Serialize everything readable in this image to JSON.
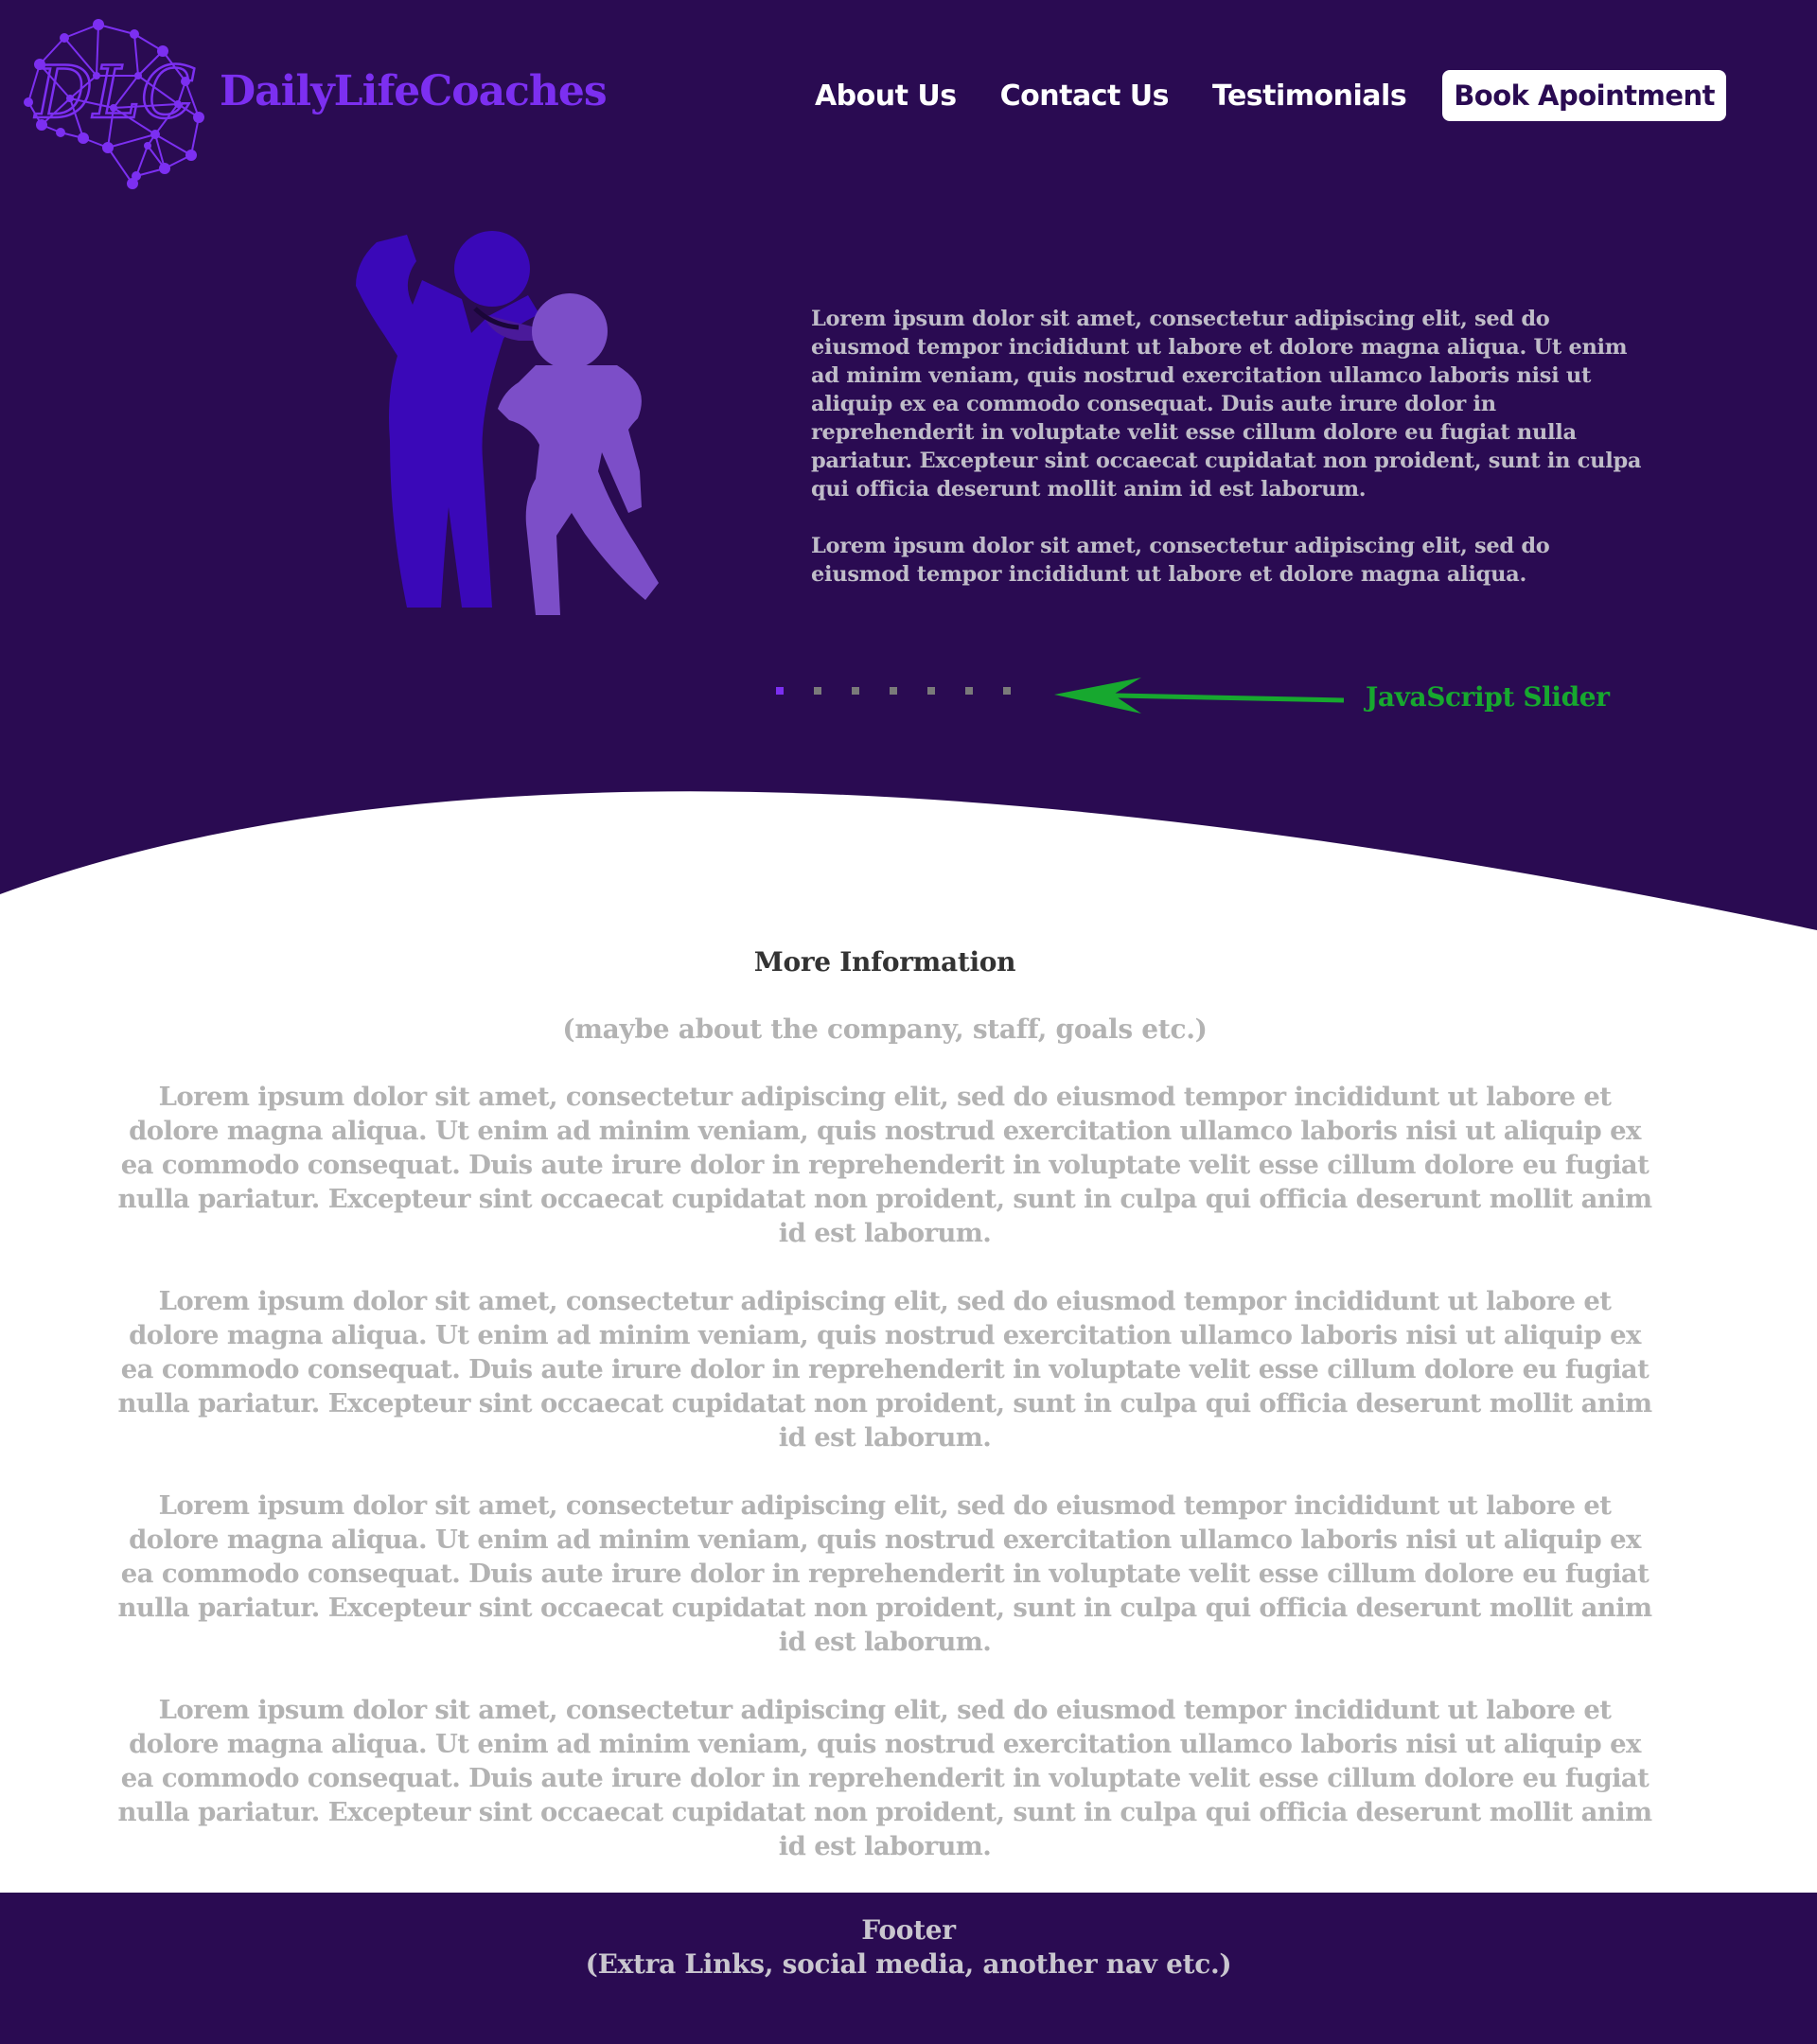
{
  "brand": {
    "name": "DailyLifeCoaches",
    "logo_letters": "DLC",
    "color": "#7c2ff1"
  },
  "nav": {
    "links": [
      "About Us",
      "Contact Us",
      "Testimonials"
    ],
    "cta": "Book Apointment"
  },
  "hero": {
    "paragraphs": [
      "Lorem ipsum dolor sit amet, consectetur adipiscing elit, sed do eiusmod tempor incididunt ut labore et dolore magna aliqua. Ut enim ad minim veniam, quis nostrud exercitation ullamco laboris nisi ut aliquip ex ea commodo consequat. Duis aute irure dolor in reprehenderit in voluptate velit esse cillum dolore eu fugiat nulla pariatur. Excepteur sint occaecat cupidatat non proident, sunt in culpa qui officia deserunt mollit anim id est laborum.",
      "Lorem ipsum dolor sit amet, consectetur adipiscing elit, sed do eiusmod tempor incididunt ut labore et dolore magna aliqua."
    ],
    "illustration_icon": "two-people-support-icon",
    "slider": {
      "slide_count": 7,
      "active_index": 0,
      "annotation": "JavaScript Slider",
      "annotation_color": "#17a82f"
    },
    "background": "#2a0b52"
  },
  "info": {
    "title": "More Information",
    "subtitle": "(maybe about the company, staff, goals etc.)",
    "paragraphs": [
      "Lorem ipsum dolor sit amet, consectetur adipiscing elit, sed do eiusmod tempor incididunt ut labore et dolore magna aliqua. Ut enim ad minim veniam, quis nostrud exercitation ullamco laboris nisi ut aliquip ex ea commodo consequat. Duis aute irure dolor in reprehenderit in voluptate velit esse cillum dolore eu fugiat nulla pariatur. Excepteur sint occaecat cupidatat non proident, sunt in culpa qui officia deserunt mollit anim id est laborum.",
      "Lorem ipsum dolor sit amet, consectetur adipiscing elit, sed do eiusmod tempor incididunt ut labore et dolore magna aliqua. Ut enim ad minim veniam, quis nostrud exercitation ullamco laboris nisi ut aliquip ex ea commodo consequat. Duis aute irure dolor in reprehenderit in voluptate velit esse cillum dolore eu fugiat nulla pariatur. Excepteur sint occaecat cupidatat non proident, sunt in culpa qui officia deserunt mollit anim id est laborum.",
      "Lorem ipsum dolor sit amet, consectetur adipiscing elit, sed do eiusmod tempor incididunt ut labore et dolore magna aliqua. Ut enim ad minim veniam, quis nostrud exercitation ullamco laboris nisi ut aliquip ex ea commodo consequat. Duis aute irure dolor in reprehenderit in voluptate velit esse cillum dolore eu fugiat nulla pariatur. Excepteur sint occaecat cupidatat non proident, sunt in culpa qui officia deserunt mollit anim id est laborum.",
      "Lorem ipsum dolor sit amet, consectetur adipiscing elit, sed do eiusmod tempor incididunt ut labore et dolore magna aliqua. Ut enim ad minim veniam, quis nostrud exercitation ullamco laboris nisi ut aliquip ex ea commodo consequat. Duis aute irure dolor in reprehenderit in voluptate velit esse cillum dolore eu fugiat nulla pariatur. Excepteur sint occaecat cupidatat non proident, sunt in culpa qui officia deserunt mollit anim id est laborum."
    ]
  },
  "footer": {
    "title": "Footer",
    "subtitle": "(Extra Links, social media, another nav etc.)"
  }
}
